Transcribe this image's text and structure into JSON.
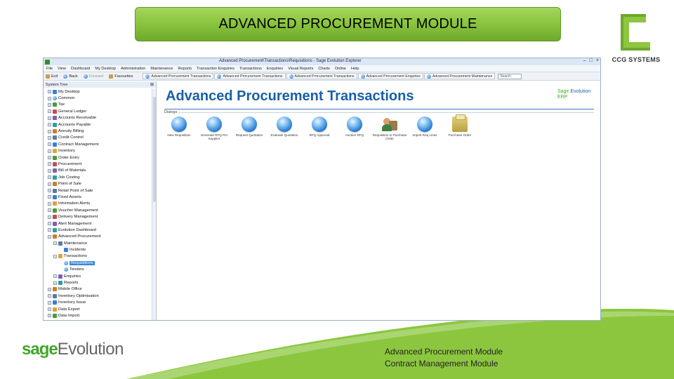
{
  "slide": {
    "title": "ADVANCED PROCUREMENT MODULE",
    "caption_lines": [
      "Advanced Procurement Module",
      "Contract Management Module"
    ],
    "sage_logo": {
      "sage": "sage",
      "evolution": "Evolution"
    },
    "ccg_logo_text": "CCG SYSTEMS",
    "colors": {
      "banner_green": "#8cc63f",
      "swoosh_green": "#8cc63f",
      "ccg_green": "#8dc63f",
      "title_blue": "#1a5fa8"
    }
  },
  "app": {
    "window_title": "Advanced Procurement\\Transactions\\Requisitions  -  Sage Evolution Explorer",
    "window_controls": [
      "–",
      "□",
      "×"
    ],
    "menu": [
      "File",
      "View",
      "Dashboard",
      "My Desktop",
      "Administration",
      "Maintenance",
      "Reports",
      "Transaction Enquiries",
      "Transactions",
      "Enquiries",
      "Visual Reports",
      "Charts",
      "Online",
      "Help"
    ],
    "toolbar": {
      "exit": "Exit",
      "back": "Back",
      "forward": "Forward",
      "favourites": "Favourites",
      "search_placeholder": "Search"
    },
    "doc_tabs": [
      "Advanced Procurement Transactions",
      "Advanced Procurement Transactions",
      "Advanced Procurement Transactions",
      "Advanced Procurement Enquiries",
      "Advanced Procurement Maintenance"
    ],
    "tree": {
      "header": "System Tree",
      "items": [
        {
          "label": "My Desktop",
          "level": 0,
          "icon": "desktop-icon"
        },
        {
          "label": "Common",
          "level": 0,
          "icon": "globe-icon"
        },
        {
          "label": "Tax",
          "level": 0,
          "icon": "tax-icon"
        },
        {
          "label": "General Ledger",
          "level": 0,
          "icon": "ledger-icon"
        },
        {
          "label": "Accounts Receivable",
          "level": 0,
          "icon": "receivable-icon"
        },
        {
          "label": "Accounts Payable",
          "level": 0,
          "icon": "payable-icon"
        },
        {
          "label": "Annuity Billing",
          "level": 0,
          "icon": "billing-icon"
        },
        {
          "label": "Credit Control",
          "level": 0,
          "icon": "credit-icon"
        },
        {
          "label": "Contract Management",
          "level": 0,
          "icon": "contract-icon"
        },
        {
          "label": "Inventory",
          "level": 0,
          "icon": "inventory-icon"
        },
        {
          "label": "Order Entry",
          "level": 0,
          "icon": "order-icon"
        },
        {
          "label": "Procurement",
          "level": 0,
          "icon": "procurement-icon"
        },
        {
          "label": "Bill of Materials",
          "level": 0,
          "icon": "bom-icon"
        },
        {
          "label": "Job Costing",
          "level": 0,
          "icon": "job-icon"
        },
        {
          "label": "Point of Sale",
          "level": 0,
          "icon": "pos-icon"
        },
        {
          "label": "Retail Point of Sale",
          "level": 0,
          "icon": "retail-icon"
        },
        {
          "label": "Fixed Assets",
          "level": 0,
          "icon": "assets-icon"
        },
        {
          "label": "Information Alerts",
          "level": 0,
          "icon": "alert-icon"
        },
        {
          "label": "Voucher Management",
          "level": 0,
          "icon": "voucher-icon"
        },
        {
          "label": "Delivery Management",
          "level": 0,
          "icon": "delivery-icon"
        },
        {
          "label": "Alert Management",
          "level": 0,
          "icon": "alert-mgmt-icon"
        },
        {
          "label": "Evolution Dashboard",
          "level": 0,
          "icon": "dashboard-icon"
        },
        {
          "label": "Advanced Procurement",
          "level": 0,
          "icon": "procurement-icon"
        },
        {
          "label": "Maintenance",
          "level": 1,
          "icon": "folder-icon"
        },
        {
          "label": "Incidents",
          "level": 2,
          "icon": "folder-icon"
        },
        {
          "label": "Transactions",
          "level": 1,
          "icon": "folder-icon"
        },
        {
          "label": "Requisitions",
          "level": 2,
          "icon": "globe-icon",
          "selected": true
        },
        {
          "label": "Tenders",
          "level": 2,
          "icon": "globe-icon"
        },
        {
          "label": "Enquiries",
          "level": 1,
          "icon": "folder-icon"
        },
        {
          "label": "Reports",
          "level": 1,
          "icon": "folder-icon"
        },
        {
          "label": "Mobile Office",
          "level": 0,
          "icon": "mobile-icon"
        },
        {
          "label": "Inventory Optimisation",
          "level": 0,
          "icon": "optimise-icon"
        },
        {
          "label": "Inventory Issue",
          "level": 0,
          "icon": "issue-icon"
        },
        {
          "label": "Data Export",
          "level": 0,
          "icon": "export-icon"
        },
        {
          "label": "Data Import",
          "level": 0,
          "icon": "import-icon"
        }
      ]
    },
    "content": {
      "title": "Advanced Procurement Transactions",
      "brand_sage": "Sage",
      "brand_evolution": "Evolution",
      "brand_erp": "ERP",
      "section_label": "Dialogs",
      "actions": [
        {
          "label": "New Requisition",
          "icon": "globe-icon"
        },
        {
          "label": "Generate RFQ Per Supplier",
          "icon": "globe-icon"
        },
        {
          "label": "Request Quotation",
          "icon": "globe-icon"
        },
        {
          "label": "Evaluate Quotation",
          "icon": "globe-icon"
        },
        {
          "label": "RFQ Approval",
          "icon": "globe-icon"
        },
        {
          "label": "Auction RFQ",
          "icon": "globe-icon"
        },
        {
          "label": "Requisition to Purchase Order",
          "icon": "people-icon"
        },
        {
          "label": "Import Req Lines",
          "icon": "globe-icon"
        },
        {
          "label": "Purchase Order",
          "icon": "folder-icon"
        }
      ]
    }
  }
}
